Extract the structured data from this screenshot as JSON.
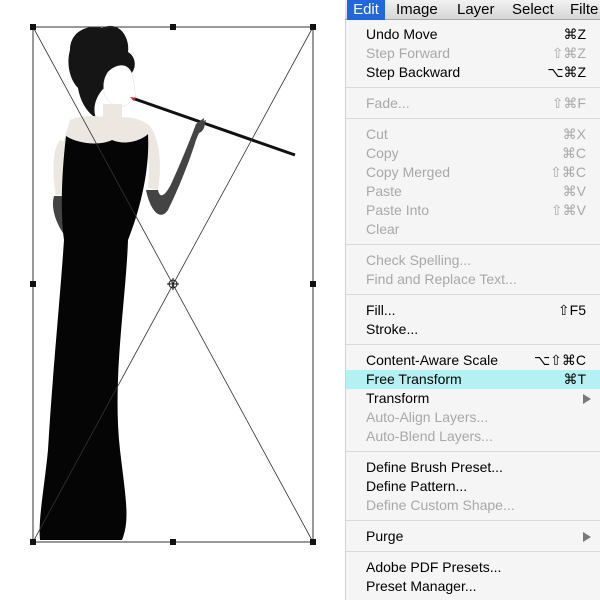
{
  "menubar": {
    "items": [
      "Edit",
      "Image",
      "Layer",
      "Select",
      "Filte"
    ],
    "active": "Edit"
  },
  "menu": {
    "groups": [
      [
        {
          "label": "Undo Move",
          "shortcut": "⌘Z",
          "enabled": true
        },
        {
          "label": "Step Forward",
          "shortcut": "⇧⌘Z",
          "enabled": false
        },
        {
          "label": "Step Backward",
          "shortcut": "⌥⌘Z",
          "enabled": true
        }
      ],
      [
        {
          "label": "Fade...",
          "shortcut": "⇧⌘F",
          "enabled": false
        }
      ],
      [
        {
          "label": "Cut",
          "shortcut": "⌘X",
          "enabled": false
        },
        {
          "label": "Copy",
          "shortcut": "⌘C",
          "enabled": false
        },
        {
          "label": "Copy Merged",
          "shortcut": "⇧⌘C",
          "enabled": false
        },
        {
          "label": "Paste",
          "shortcut": "⌘V",
          "enabled": false
        },
        {
          "label": "Paste Into",
          "shortcut": "⇧⌘V",
          "enabled": false
        },
        {
          "label": "Clear",
          "shortcut": "",
          "enabled": false
        }
      ],
      [
        {
          "label": "Check Spelling...",
          "shortcut": "",
          "enabled": false
        },
        {
          "label": "Find and Replace Text...",
          "shortcut": "",
          "enabled": false
        }
      ],
      [
        {
          "label": "Fill...",
          "shortcut": "⇧F5",
          "enabled": true
        },
        {
          "label": "Stroke...",
          "shortcut": "",
          "enabled": true
        }
      ],
      [
        {
          "label": "Content-Aware Scale",
          "shortcut": "⌥⇧⌘C",
          "enabled": true
        },
        {
          "label": "Free Transform",
          "shortcut": "⌘T",
          "enabled": true,
          "highlighted": true
        },
        {
          "label": "Transform",
          "shortcut": "",
          "enabled": true,
          "submenu": true
        },
        {
          "label": "Auto-Align Layers...",
          "shortcut": "",
          "enabled": false
        },
        {
          "label": "Auto-Blend Layers...",
          "shortcut": "",
          "enabled": false
        }
      ],
      [
        {
          "label": "Define Brush Preset...",
          "shortcut": "",
          "enabled": true
        },
        {
          "label": "Define Pattern...",
          "shortcut": "",
          "enabled": true
        },
        {
          "label": "Define Custom Shape...",
          "shortcut": "",
          "enabled": false
        }
      ],
      [
        {
          "label": "Purge",
          "shortcut": "",
          "enabled": true,
          "submenu": true
        }
      ],
      [
        {
          "label": "Adobe PDF Presets...",
          "shortcut": "",
          "enabled": true
        },
        {
          "label": "Preset Manager...",
          "shortcut": "",
          "enabled": true
        }
      ]
    ]
  },
  "colors": {
    "menu_highlight": "#b3f2f2",
    "active_menu": "#1f66e0",
    "disabled_text": "#a8a8a8"
  }
}
